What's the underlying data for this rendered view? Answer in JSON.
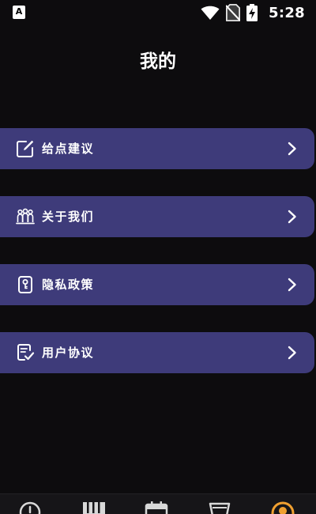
{
  "status_bar": {
    "left_badge": "A",
    "time": "5:28",
    "icons": [
      "wifi-icon",
      "no-sim-icon",
      "battery-charging-icon"
    ]
  },
  "header": {
    "title": "我的"
  },
  "menu": {
    "items": [
      {
        "label": "给点建议",
        "icon": "edit-icon"
      },
      {
        "label": "关于我们",
        "icon": "people-icon"
      },
      {
        "label": "隐私政策",
        "icon": "privacy-icon"
      },
      {
        "label": "用户协议",
        "icon": "agreement-icon"
      }
    ]
  },
  "bottom_nav": {
    "tabs": [
      {
        "icon": "clock-icon"
      },
      {
        "icon": "piano-icon"
      },
      {
        "icon": "calendar-icon"
      },
      {
        "icon": "cup-icon"
      },
      {
        "icon": "profile-icon",
        "active": true
      }
    ]
  },
  "colors": {
    "background": "#0d0c0e",
    "menu_item": "#3e3b7a",
    "text": "#ffffff",
    "active_tab": "#f0a030"
  }
}
